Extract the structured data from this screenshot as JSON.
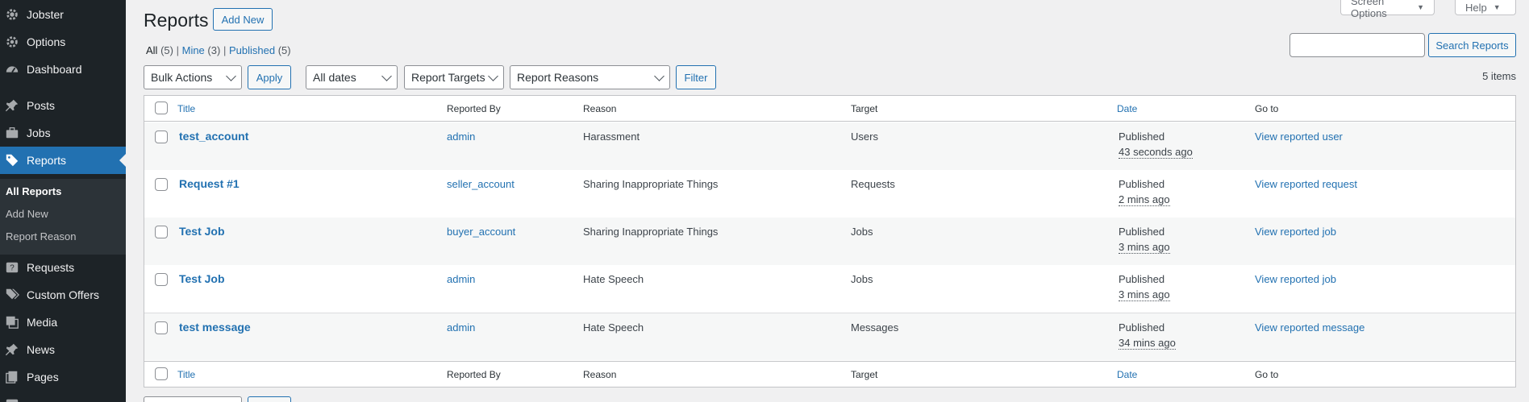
{
  "sidebar": {
    "items": [
      {
        "label": "Jobster",
        "icon": "gear-icon"
      },
      {
        "label": "Options",
        "icon": "gear-icon"
      },
      {
        "label": "Dashboard",
        "icon": "dashboard-icon"
      },
      {
        "label": "Posts",
        "icon": "pin-icon"
      },
      {
        "label": "Jobs",
        "icon": "briefcase-icon"
      },
      {
        "label": "Reports",
        "icon": "tag-icon"
      },
      {
        "label": "Requests",
        "icon": "question-icon"
      },
      {
        "label": "Custom Offers",
        "icon": "tags-icon"
      },
      {
        "label": "Media",
        "icon": "media-icon"
      },
      {
        "label": "News",
        "icon": "pin-icon"
      },
      {
        "label": "Pages",
        "icon": "pages-icon"
      }
    ],
    "submenu": [
      "All Reports",
      "Add New",
      "Report Reason"
    ]
  },
  "header": {
    "title": "Reports",
    "add_new": "Add New",
    "screen_options": "Screen Options",
    "help": "Help"
  },
  "views": {
    "all": "All",
    "all_count": "(5)",
    "mine": "Mine",
    "mine_count": "(3)",
    "published": "Published",
    "published_count": "(5)",
    "sep": "|"
  },
  "search": {
    "value": "",
    "button": "Search Reports"
  },
  "filters": {
    "bulk_actions": "Bulk Actions",
    "apply": "Apply",
    "dates": "All dates",
    "targets": "Report Targets",
    "reasons": "Report Reasons",
    "filter": "Filter",
    "items_count": "5 items"
  },
  "table": {
    "columns": {
      "title": "Title",
      "reported_by": "Reported By",
      "reason": "Reason",
      "target": "Target",
      "date": "Date",
      "go_to": "Go to"
    },
    "rows": [
      {
        "title": "test_account",
        "reported_by": "admin",
        "reason": "Harassment",
        "target": "Users",
        "status": "Published",
        "date": "43 seconds ago",
        "go_to": "View reported user"
      },
      {
        "title": "Request #1",
        "reported_by": "seller_account",
        "reason": "Sharing Inappropriate Things",
        "target": "Requests",
        "status": "Published",
        "date": "2 mins ago",
        "go_to": "View reported request"
      },
      {
        "title": "Test Job",
        "reported_by": "buyer_account",
        "reason": "Sharing Inappropriate Things",
        "target": "Jobs",
        "status": "Published",
        "date": "3 mins ago",
        "go_to": "View reported job"
      },
      {
        "title": "Test Job",
        "reported_by": "admin",
        "reason": "Hate Speech",
        "target": "Jobs",
        "status": "Published",
        "date": "3 mins ago",
        "go_to": "View reported job"
      },
      {
        "title": "test message",
        "reported_by": "admin",
        "reason": "Hate Speech",
        "target": "Messages",
        "status": "Published",
        "date": "34 mins ago",
        "go_to": "View reported message"
      }
    ]
  },
  "colors": {
    "accent": "#2271b1",
    "sidebar_bg": "#1d2327",
    "page_bg": "#f0f0f1"
  }
}
